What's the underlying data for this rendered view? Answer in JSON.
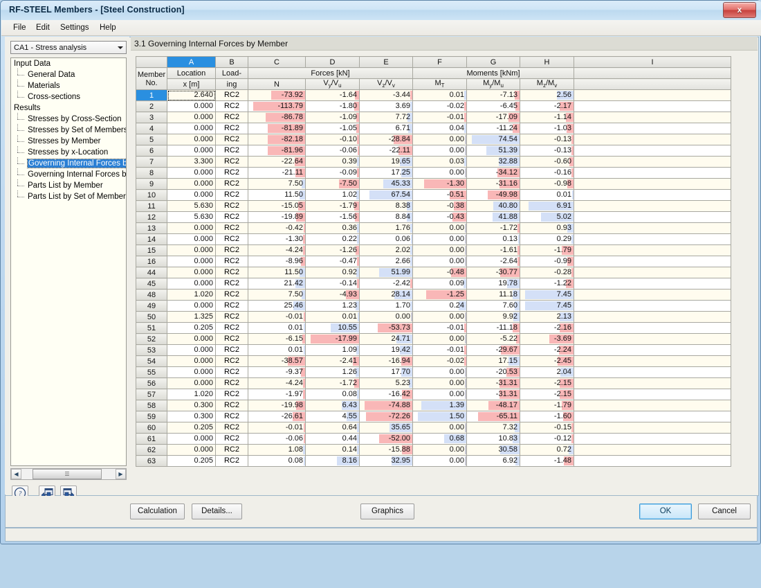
{
  "window": {
    "title": "RF-STEEL Members - [Steel Construction]",
    "close_label": "x"
  },
  "menu": {
    "items": [
      "File",
      "Edit",
      "Settings",
      "Help"
    ]
  },
  "sidebar": {
    "combo": {
      "value": "CA1 - Stress analysis"
    },
    "tree": [
      {
        "label": "Input Data",
        "level": "root",
        "selected": false
      },
      {
        "label": "General Data",
        "level": "child",
        "selected": false
      },
      {
        "label": "Materials",
        "level": "child",
        "selected": false
      },
      {
        "label": "Cross-sections",
        "level": "child",
        "selected": false
      },
      {
        "label": "Results",
        "level": "root",
        "selected": false
      },
      {
        "label": "Stresses by Cross-Section",
        "level": "child",
        "selected": false
      },
      {
        "label": "Stresses by Set of Members",
        "level": "child",
        "selected": false
      },
      {
        "label": "Stresses by Member",
        "level": "child",
        "selected": false
      },
      {
        "label": "Stresses by x-Location",
        "level": "child",
        "selected": false
      },
      {
        "label": "Governing Internal Forces by M",
        "level": "child",
        "selected": true
      },
      {
        "label": "Governing Internal Forces by S",
        "level": "child",
        "selected": false
      },
      {
        "label": "Parts List by Member",
        "level": "child",
        "selected": false
      },
      {
        "label": "Parts List by Set of Members",
        "level": "child",
        "selected": false
      }
    ]
  },
  "panel": {
    "title": "3.1 Governing Internal Forces by Member"
  },
  "grid": {
    "column_letters": [
      "A",
      "B",
      "C",
      "D",
      "E",
      "F",
      "G",
      "H",
      "I"
    ],
    "active_column": "A",
    "group_headers": {
      "forces": "Forces [kN]",
      "moments": "Moments [kNm]"
    },
    "headers": {
      "member_line1": "Member",
      "member_line2": "No.",
      "location_line1": "Location",
      "location_line2": "x [m]",
      "loading_line1": "Load-",
      "loading_line2": "ing",
      "n": "N",
      "vy": "Vy/Vu",
      "vz": "Vz/Vv",
      "mt": "MT",
      "my": "My/Mu",
      "mz": "Mz/Mv"
    },
    "max_abs": {
      "N": 113.79,
      "Vy": 17.99,
      "Vz": 74.88,
      "MT": 1.5,
      "My": 74.54,
      "Mz": 7.45
    },
    "rows": [
      {
        "no": "1",
        "x": "2.640",
        "load": "RC2",
        "N": "-73.92",
        "Vy": "-1.64",
        "Vz": "-3.44",
        "MT": "0.01",
        "My": "-7.13",
        "Mz": "2.56",
        "selected": true
      },
      {
        "no": "2",
        "x": "0.000",
        "load": "RC2",
        "N": "-113.79",
        "Vy": "-1.80",
        "Vz": "3.69",
        "MT": "-0.02",
        "My": "-6.45",
        "Mz": "-2.17",
        "selected": false
      },
      {
        "no": "3",
        "x": "0.000",
        "load": "RC2",
        "N": "-86.78",
        "Vy": "-1.09",
        "Vz": "7.72",
        "MT": "-0.01",
        "My": "-17.09",
        "Mz": "-1.14",
        "selected": false
      },
      {
        "no": "4",
        "x": "0.000",
        "load": "RC2",
        "N": "-81.89",
        "Vy": "-1.05",
        "Vz": "6.71",
        "MT": "0.04",
        "My": "-11.24",
        "Mz": "-1.03",
        "selected": false
      },
      {
        "no": "5",
        "x": "0.000",
        "load": "RC2",
        "N": "-82.18",
        "Vy": "-0.10",
        "Vz": "-28.84",
        "MT": "0.00",
        "My": "74.54",
        "Mz": "-0.13",
        "selected": false
      },
      {
        "no": "6",
        "x": "0.000",
        "load": "RC2",
        "N": "-81.96",
        "Vy": "-0.06",
        "Vz": "-22.11",
        "MT": "0.00",
        "My": "51.39",
        "Mz": "-0.13",
        "selected": false
      },
      {
        "no": "7",
        "x": "3.300",
        "load": "RC2",
        "N": "-22.64",
        "Vy": "0.39",
        "Vz": "19.65",
        "MT": "0.03",
        "My": "32.88",
        "Mz": "-0.60",
        "selected": false
      },
      {
        "no": "8",
        "x": "0.000",
        "load": "RC2",
        "N": "-21.11",
        "Vy": "-0.09",
        "Vz": "17.25",
        "MT": "0.00",
        "My": "-34.12",
        "Mz": "-0.16",
        "selected": false
      },
      {
        "no": "9",
        "x": "0.000",
        "load": "RC2",
        "N": "7.50",
        "Vy": "-7.50",
        "Vz": "45.33",
        "MT": "-1.30",
        "My": "-31.16",
        "Mz": "-0.98",
        "selected": false
      },
      {
        "no": "10",
        "x": "0.000",
        "load": "RC2",
        "N": "11.50",
        "Vy": "1.02",
        "Vz": "67.54",
        "MT": "-0.51",
        "My": "-49.98",
        "Mz": "0.01",
        "selected": false
      },
      {
        "no": "11",
        "x": "5.630",
        "load": "RC2",
        "N": "-15.05",
        "Vy": "-1.79",
        "Vz": "8.38",
        "MT": "-0.38",
        "My": "40.80",
        "Mz": "6.91",
        "selected": false
      },
      {
        "no": "12",
        "x": "5.630",
        "load": "RC2",
        "N": "-19.89",
        "Vy": "-1.56",
        "Vz": "8.84",
        "MT": "-0.43",
        "My": "41.88",
        "Mz": "5.02",
        "selected": false
      },
      {
        "no": "13",
        "x": "0.000",
        "load": "RC2",
        "N": "-0.42",
        "Vy": "0.36",
        "Vz": "1.76",
        "MT": "0.00",
        "My": "-1.72",
        "Mz": "0.93",
        "selected": false
      },
      {
        "no": "14",
        "x": "0.000",
        "load": "RC2",
        "N": "-1.30",
        "Vy": "0.22",
        "Vz": "0.06",
        "MT": "0.00",
        "My": "0.13",
        "Mz": "0.29",
        "selected": false
      },
      {
        "no": "15",
        "x": "0.000",
        "load": "RC2",
        "N": "-4.24",
        "Vy": "-1.26",
        "Vz": "2.02",
        "MT": "0.00",
        "My": "-1.61",
        "Mz": "-1.79",
        "selected": false
      },
      {
        "no": "16",
        "x": "0.000",
        "load": "RC2",
        "N": "-8.96",
        "Vy": "-0.47",
        "Vz": "2.66",
        "MT": "0.00",
        "My": "-2.64",
        "Mz": "-0.99",
        "selected": false
      },
      {
        "no": "44",
        "x": "0.000",
        "load": "RC2",
        "N": "11.50",
        "Vy": "0.92",
        "Vz": "51.99",
        "MT": "-0.48",
        "My": "-30.77",
        "Mz": "-0.28",
        "selected": false
      },
      {
        "no": "45",
        "x": "0.000",
        "load": "RC2",
        "N": "21.42",
        "Vy": "-0.14",
        "Vz": "-2.42",
        "MT": "0.09",
        "My": "19.78",
        "Mz": "-1.22",
        "selected": false
      },
      {
        "no": "48",
        "x": "1.020",
        "load": "RC2",
        "N": "7.50",
        "Vy": "-4.93",
        "Vz": "28.14",
        "MT": "-1.25",
        "My": "11.18",
        "Mz": "7.45",
        "selected": false
      },
      {
        "no": "49",
        "x": "0.000",
        "load": "RC2",
        "N": "25.46",
        "Vy": "1.23",
        "Vz": "1.70",
        "MT": "0.24",
        "My": "7.60",
        "Mz": "7.45",
        "selected": false
      },
      {
        "no": "50",
        "x": "1.325",
        "load": "RC2",
        "N": "-0.01",
        "Vy": "0.01",
        "Vz": "0.00",
        "MT": "0.00",
        "My": "9.92",
        "Mz": "2.13",
        "selected": false
      },
      {
        "no": "51",
        "x": "0.205",
        "load": "RC2",
        "N": "0.01",
        "Vy": "10.55",
        "Vz": "-53.73",
        "MT": "-0.01",
        "My": "-11.18",
        "Mz": "-2.16",
        "selected": false
      },
      {
        "no": "52",
        "x": "0.000",
        "load": "RC2",
        "N": "-6.15",
        "Vy": "-17.99",
        "Vz": "24.71",
        "MT": "0.00",
        "My": "-5.22",
        "Mz": "-3.69",
        "selected": false
      },
      {
        "no": "53",
        "x": "0.000",
        "load": "RC2",
        "N": "0.01",
        "Vy": "1.09",
        "Vz": "19.42",
        "MT": "-0.01",
        "My": "-29.67",
        "Mz": "-2.24",
        "selected": false
      },
      {
        "no": "54",
        "x": "0.000",
        "load": "RC2",
        "N": "-38.57",
        "Vy": "-2.41",
        "Vz": "-16.94",
        "MT": "-0.02",
        "My": "17.15",
        "Mz": "-2.45",
        "selected": false
      },
      {
        "no": "55",
        "x": "0.000",
        "load": "RC2",
        "N": "-9.37",
        "Vy": "1.26",
        "Vz": "17.70",
        "MT": "0.00",
        "My": "-20.53",
        "Mz": "2.04",
        "selected": false
      },
      {
        "no": "56",
        "x": "0.000",
        "load": "RC2",
        "N": "-4.24",
        "Vy": "-1.72",
        "Vz": "5.23",
        "MT": "0.00",
        "My": "-31.31",
        "Mz": "-2.15",
        "selected": false
      },
      {
        "no": "57",
        "x": "1.020",
        "load": "RC2",
        "N": "-1.97",
        "Vy": "0.08",
        "Vz": "-16.42",
        "MT": "0.00",
        "My": "-31.31",
        "Mz": "-2.15",
        "selected": false
      },
      {
        "no": "58",
        "x": "0.300",
        "load": "RC2",
        "N": "-19.98",
        "Vy": "6.43",
        "Vz": "-74.88",
        "MT": "1.39",
        "My": "-48.17",
        "Mz": "-1.79",
        "selected": false
      },
      {
        "no": "59",
        "x": "0.300",
        "load": "RC2",
        "N": "-26.61",
        "Vy": "4.55",
        "Vz": "-72.26",
        "MT": "1.50",
        "My": "-65.11",
        "Mz": "-1.60",
        "selected": false
      },
      {
        "no": "60",
        "x": "0.205",
        "load": "RC2",
        "N": "-0.01",
        "Vy": "0.64",
        "Vz": "35.65",
        "MT": "0.00",
        "My": "7.32",
        "Mz": "-0.15",
        "selected": false
      },
      {
        "no": "61",
        "x": "0.000",
        "load": "RC2",
        "N": "-0.06",
        "Vy": "0.44",
        "Vz": "-52.00",
        "MT": "0.68",
        "My": "10.83",
        "Mz": "-0.12",
        "selected": false
      },
      {
        "no": "62",
        "x": "0.000",
        "load": "RC2",
        "N": "1.08",
        "Vy": "0.14",
        "Vz": "-15.88",
        "MT": "0.00",
        "My": "30.58",
        "Mz": "0.72",
        "selected": false
      },
      {
        "no": "63",
        "x": "0.205",
        "load": "RC2",
        "N": "0.08",
        "Vy": "8.16",
        "Vz": "32.95",
        "MT": "0.00",
        "My": "6.92",
        "Mz": "-1.48",
        "selected": false
      }
    ]
  },
  "grid_toolbar": {
    "buttons": [
      {
        "name": "result-table-icon",
        "active": true
      },
      {
        "name": "view-mode-icon",
        "active": false
      },
      {
        "name": "export-excel-icon",
        "active": false
      },
      {
        "name": "select-pointer-icon",
        "active": false
      },
      {
        "name": "visibility-eye-icon",
        "active": false
      }
    ]
  },
  "sidebar_buttons": [
    {
      "name": "help-button"
    },
    {
      "name": "previous-button"
    },
    {
      "name": "next-button"
    }
  ],
  "footer": {
    "calculation": "Calculation",
    "details": "Details...",
    "graphics": "Graphics",
    "ok": "OK",
    "cancel": "Cancel"
  },
  "colors": {
    "accent": "#2a8fe0",
    "negative_bar": "#f9b7b7",
    "positive_bar": "#d4e0f7",
    "alt_row": "#fffcef"
  }
}
